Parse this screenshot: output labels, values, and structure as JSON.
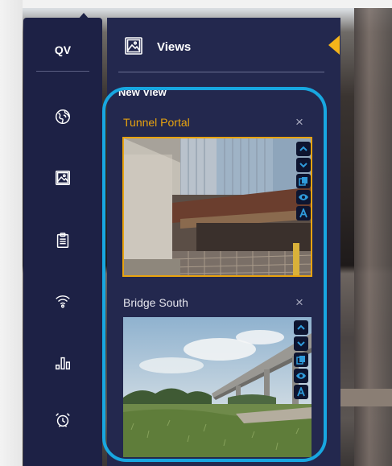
{
  "rail": {
    "title": "QV",
    "icons": [
      "globe-icon",
      "image-icon",
      "clipboard-icon",
      "wifi-icon",
      "bar-chart-icon",
      "alarm-clock-icon"
    ]
  },
  "panel": {
    "title": "Views",
    "section_label": "New View",
    "views": [
      {
        "title": "Tunnel Portal",
        "close": "×",
        "selected": true
      },
      {
        "title": "Bridge South",
        "close": "×",
        "selected": false
      }
    ],
    "thumb_buttons": [
      "up-chevron-icon",
      "down-chevron-icon",
      "copy-icon",
      "eye-icon",
      "annotate-icon"
    ]
  },
  "colors": {
    "rail_bg": "#1d2145",
    "panel_bg": "#23284e",
    "selected_accent": "#e8a30f",
    "highlight_ring": "#18a7e0",
    "button_icon": "#2f9bdb"
  }
}
